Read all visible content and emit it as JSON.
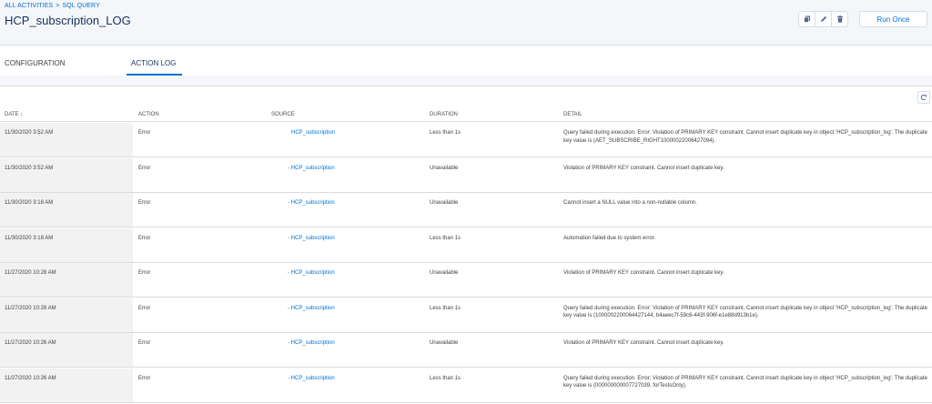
{
  "breadcrumb": {
    "items": [
      "ALL ACTIVITIES",
      "SQL QUERY"
    ],
    "separator": ">"
  },
  "page_title": "HCP_subscription_LOG",
  "toolbar": {
    "run_label": "Run Once",
    "icons": [
      "copy-icon",
      "edit-icon",
      "delete-icon"
    ]
  },
  "tabs": [
    {
      "label": "CONFIGURATION"
    },
    {
      "label": "ACTION LOG"
    }
  ],
  "active_tab": "ACTION LOG",
  "table": {
    "columns": [
      "DATE",
      "ACTION",
      "SOURCE",
      "DURATION",
      "DETAIL"
    ],
    "sort_indicator": "↓",
    "rows": [
      {
        "date": "11/30/2020 3:52 AM",
        "action": "Error",
        "source": "HCP_subscription",
        "duration": "Less than 1s",
        "detail": "Query failed during execution. Error: Violation of PRIMARY KEY constraint. Cannot insert duplicate key in object 'HCP_subscription_log'. The duplicate key value is (AET_SUBSCRIBE_RIGHT10000022006427094)."
      },
      {
        "date": "11/30/2020 3:52 AM",
        "action": "Error",
        "source": "- HCP_subscription",
        "duration": "Unavailable",
        "detail": "Violation of PRIMARY KEY constraint. Cannot insert duplicate key."
      },
      {
        "date": "11/30/2020 3:18 AM",
        "action": "Error",
        "source": "- HCP_subscription",
        "duration": "Unavailable",
        "detail": "Cannot insert a NULL value into a non-nullable column."
      },
      {
        "date": "11/30/2020 3:18 AM",
        "action": "Error",
        "source": "- HCP_subscription",
        "duration": "Less than 1s",
        "detail": "Automation failed due to system error."
      },
      {
        "date": "11/27/2020 10:28 AM",
        "action": "Error",
        "source": "- HCP_subscription",
        "duration": "Unavailable",
        "detail": "Violation of PRIMARY KEY constraint. Cannot insert duplicate key."
      },
      {
        "date": "11/27/2020 10:28 AM",
        "action": "Error",
        "source": "- HCP_subscription",
        "duration": "Less than 1s",
        "detail": "Query failed during execution. Error: Violation of PRIMARY KEY constraint. Cannot insert duplicate key in object 'HCP_subscription_log'. The duplicate key value is (1000002200064427144, b4aeec7f-59c6-443f-906f-e1e88d913b1e)."
      },
      {
        "date": "11/27/2020 10:26 AM",
        "action": "Error",
        "source": "- HCP_subscription",
        "duration": "Unavailable",
        "detail": "Violation of PRIMARY KEY constraint. Cannot insert duplicate key."
      },
      {
        "date": "11/27/2020 10:26 AM",
        "action": "Error",
        "source": "- HCP_subscription",
        "duration": "Less than 1s",
        "detail": "Query failed during execution. Error: Violation of PRIMARY KEY constraint. Cannot insert duplicate key in object 'HCP_subscription_log'. The duplicate key value is (000000000007727039, forTestsOnly)."
      }
    ]
  },
  "colors": {
    "link": "#0070d2",
    "title": "#16325c",
    "header_bg": "#f4f6f9",
    "date_col_bg": "#f3f2f2"
  }
}
